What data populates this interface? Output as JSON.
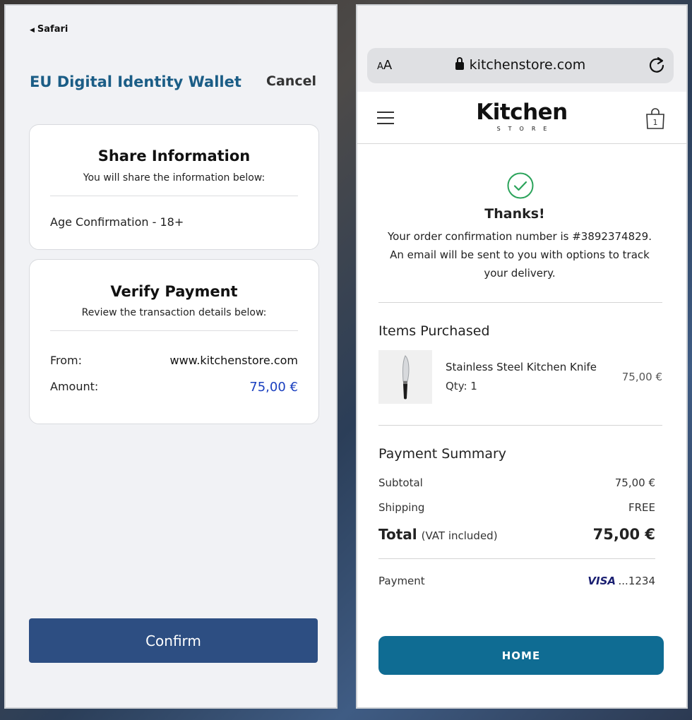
{
  "wallet": {
    "back_label": "Safari",
    "title": "EU Digital Identity Wallet",
    "cancel_label": "Cancel",
    "share": {
      "title": "Share Information",
      "subtitle": "You will share the information below:",
      "item": "Age Confirmation - 18+"
    },
    "payment": {
      "title": "Verify Payment",
      "subtitle": "Review the transaction details below:",
      "from_label": "From:",
      "from_value": "www.kitchenstore.com",
      "amount_label": "Amount:",
      "amount_value": "75,00 €",
      "amount_color": "#1a3fbf"
    },
    "confirm_label": "Confirm",
    "confirm_color": "#2d4e82"
  },
  "store": {
    "aa_label": "AA",
    "url": "kitchenstore.com",
    "logo_main": "Kitchen",
    "logo_sub": "STORE",
    "cart_count": "1",
    "thanks": "Thanks!",
    "confirmation_line1": "Your order confirmation number is #3892374829.",
    "confirmation_line2": "An email will be sent to you with options to track",
    "confirmation_line3": "your delivery.",
    "items_title": "Items Purchased",
    "product": {
      "name": "Stainless Steel Kitchen Knife",
      "qty": "Qty: 1",
      "price": "75,00 €"
    },
    "summary_title": "Payment Summary",
    "subtotal_label": "Subtotal",
    "subtotal_value": "75,00 €",
    "shipping_label": "Shipping",
    "shipping_value": "FREE",
    "total_label": "Total",
    "total_note": "(VAT included)",
    "total_value": "75,00 €",
    "payment_label": "Payment",
    "card_brand": "VISA",
    "card_last": "...1234",
    "home_label": "HOME",
    "accent_color": "#0f6c93",
    "check_color": "#2aa35a"
  }
}
